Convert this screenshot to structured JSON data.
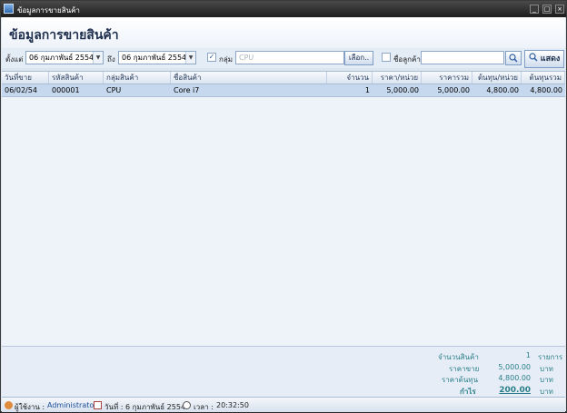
{
  "window": {
    "title": "ข้อมูลการขายสินค้า"
  },
  "header": {
    "title": "ข้อมูลการขายสินค้า"
  },
  "filter": {
    "from_label": "ตั้งแต่",
    "from_day": "06",
    "from_month_year": "กุมภาพันธ์   2554",
    "to_label": "ถึง",
    "to_day": "06",
    "to_month_year": "กุมภาพันธ์   2554",
    "group_label": "กลุ่ม",
    "group_checked": true,
    "group_value": "CPU",
    "select_button": "เลือก..",
    "customer_label": "ชื่อลูกค้า",
    "customer_checked": false,
    "customer_value": "",
    "show_button": "แสดง"
  },
  "table": {
    "headers": [
      "วันที่ขาย",
      "รหัสสินค้า",
      "กลุ่มสินค้า",
      "ชื่อสินค้า",
      "จำนวน",
      "ราคา/หน่วย",
      "ราคารวม",
      "ต้นทุน/หน่วย",
      "ต้นทุนรวม"
    ],
    "rows": [
      [
        "06/02/54",
        "000001",
        "CPU",
        "Core i7",
        "1",
        "5,000.00",
        "5,000.00",
        "4,800.00",
        "4,800.00"
      ]
    ]
  },
  "summary": {
    "qty_label": "จำนวนสินค้า",
    "qty_value": "1",
    "qty_unit": "รายการ",
    "sale_label": "ราคาขาย",
    "sale_value": "5,000.00",
    "sale_unit": "บาท",
    "cost_label": "ราคาต้นทุน",
    "cost_value": "4,800.00",
    "cost_unit": "บาท",
    "profit_label": "กำไร",
    "profit_value": "200.00",
    "profit_unit": "บาท"
  },
  "status": {
    "user_label": "ผู้ใช้งาน :",
    "user_value": "Administrator",
    "date_label": "วันที่ :",
    "date_value": "6 กุมภาพันธ์ 2554",
    "time_label": "เวลา :",
    "time_value": "20:32:50"
  },
  "colors": {
    "accent": "#2d5fa0",
    "summary_text": "#2a7f8a",
    "row_selected": "#c6d8ee"
  }
}
